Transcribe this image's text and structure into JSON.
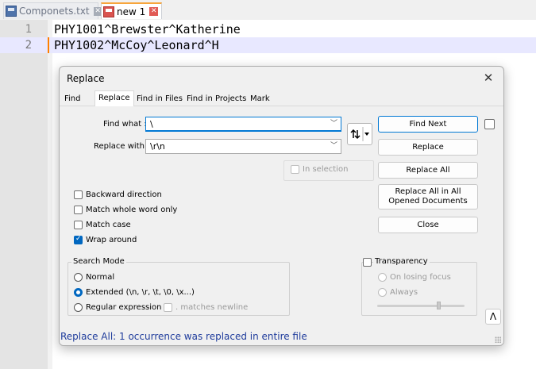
{
  "tabs": [
    {
      "label": "Componets.txt",
      "active": false
    },
    {
      "label": "new 1",
      "active": true
    }
  ],
  "editor": {
    "lines": [
      {
        "num": "1",
        "text": "PHY1001^Brewster^Katherine"
      },
      {
        "num": "2",
        "text": "PHY1002^McCoy^Leonard^H"
      }
    ]
  },
  "dialog": {
    "title": "Replace",
    "close_glyph": "✕",
    "tabs": [
      "Find",
      "Replace",
      "Find in Files",
      "Find in Projects",
      "Mark"
    ],
    "find_label": "Find what :",
    "find_value": "\\",
    "replace_label": "Replace with :",
    "replace_value": "\\r\\n",
    "in_selection_label": "In selection",
    "buttons": {
      "find_next": "Find Next",
      "replace": "Replace",
      "replace_all": "Replace All",
      "replace_all_opened": "Replace All in All Opened Documents",
      "close": "Close"
    },
    "options": {
      "backward": "Backward direction",
      "whole_word": "Match whole word only",
      "match_case": "Match case",
      "wrap_around": "Wrap around"
    },
    "wrap_around_checked": true,
    "search_mode": {
      "title": "Search Mode",
      "normal": "Normal",
      "extended": "Extended (\\n, \\r, \\t, \\0, \\x...)",
      "regex": "Regular expression",
      "matches_newline": ". matches newline",
      "selected": "extended"
    },
    "transparency": {
      "title": "Transparency",
      "on_losing_focus": "On losing focus",
      "always": "Always"
    },
    "up_glyph": "ᐱ",
    "status": "Replace All: 1 occurrence was replaced in entire file"
  }
}
